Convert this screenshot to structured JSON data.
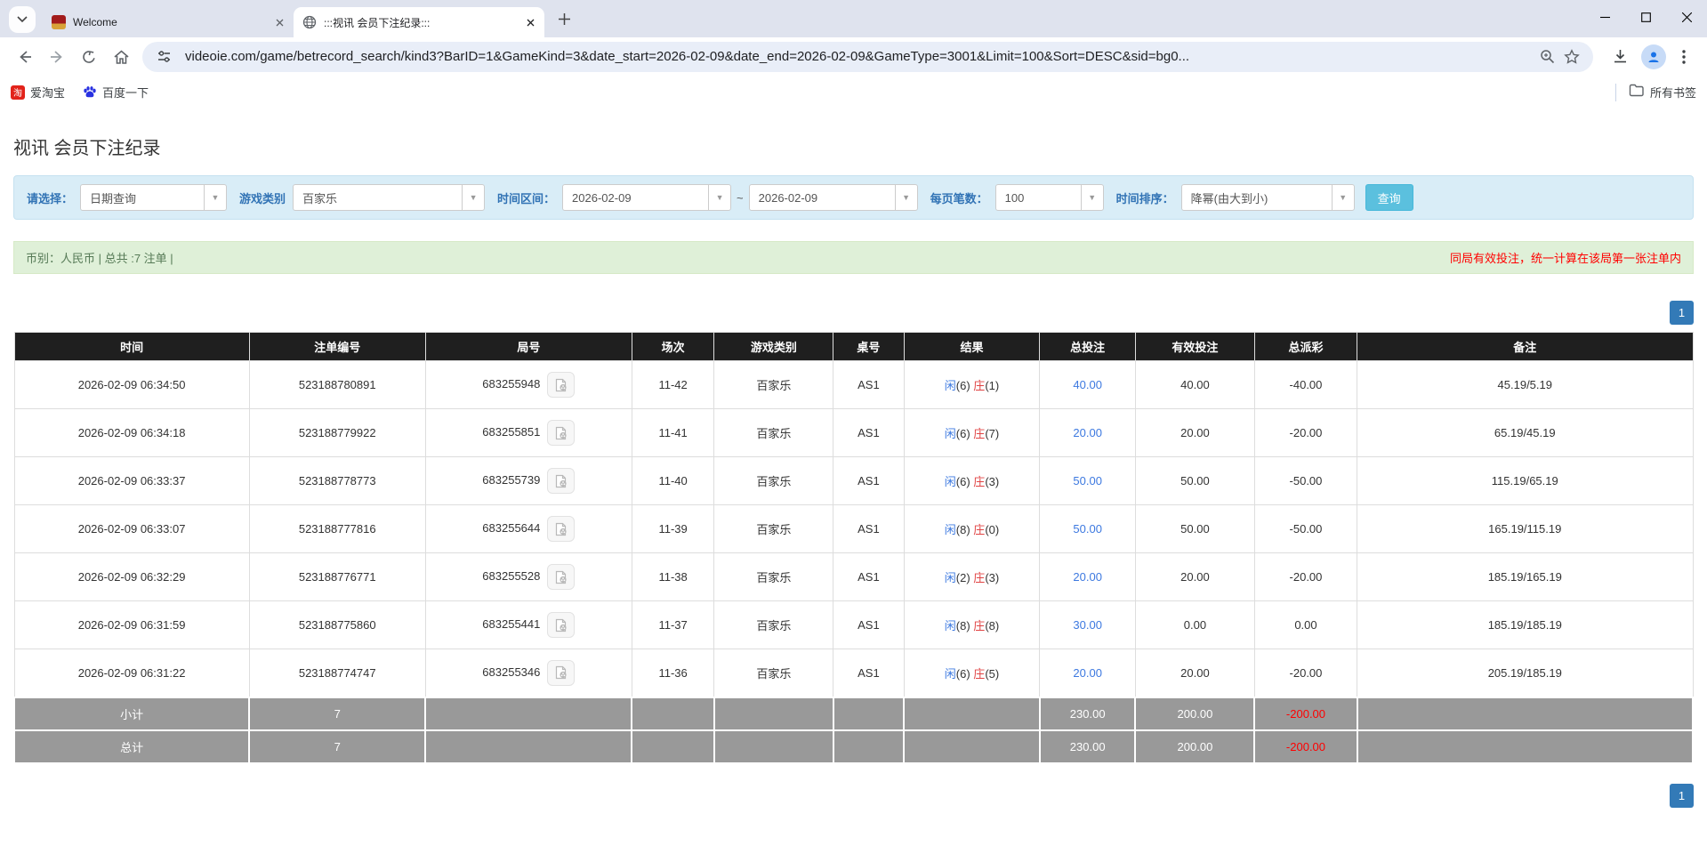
{
  "browser": {
    "tabs": [
      {
        "title": "Welcome"
      },
      {
        "title": ":::视讯 会员下注纪录:::"
      }
    ],
    "url": "videoie.com/game/betrecord_search/kind3?BarID=1&GameKind=3&date_start=2026-02-09&date_end=2026-02-09&GameType=3001&Limit=100&Sort=DESC&sid=bg0...",
    "bookmarks": [
      {
        "label": "爱淘宝",
        "icon": "taobao-icon",
        "icon_char": "淘"
      },
      {
        "label": "百度一下",
        "icon": "baidu-paw-icon"
      }
    ],
    "bookmarks_right": "所有书签"
  },
  "page": {
    "title": "视讯 会员下注纪录",
    "filters": {
      "select_label": "请选择：",
      "select_value": "日期查询",
      "game_label": "游戏类别",
      "game_value": "百家乐",
      "range_label": "时间区间：",
      "date_start": "2026-02-09",
      "tilde": "~",
      "date_end": "2026-02-09",
      "per_page_label": "每页笔数：",
      "per_page_value": "100",
      "sort_label": "时间排序：",
      "sort_value": "降幂(由大到小)",
      "search_button": "查询"
    },
    "info_bar": {
      "left": "币别：人民币 | 总共 :7 注单 |",
      "right": "同局有效投注，统一计算在该局第一张注单内"
    },
    "pagination": "1",
    "colors": {
      "accent_blue": "#3d79e0",
      "banker_red": "#e04343",
      "negative_red": "#ff0000",
      "header_bg": "#1f1f1f",
      "summary_bg": "#999999",
      "filter_bg": "#d9edf7",
      "info_bg": "#dff0d8",
      "search_btn": "#5bc0de",
      "pager_btn": "#337ab7"
    },
    "table": {
      "headers": [
        "时间",
        "注单编号",
        "局号",
        "场次",
        "游戏类别",
        "桌号",
        "结果",
        "总投注",
        "有效投注",
        "总派彩",
        "备注"
      ],
      "col_widths": [
        "14%",
        "10.5%",
        "12.3%",
        "4.9%",
        "7.1%",
        "4.2%",
        "8.1%",
        "5.7%",
        "7.1%",
        "6.1%",
        "20%"
      ],
      "rows": [
        {
          "time": "2026-02-09 06:34:50",
          "bet_id": "523188780891",
          "round": "683255948",
          "session": "11-42",
          "game": "百家乐",
          "table_no": "AS1",
          "result_player": "闲(6)",
          "result_banker": "庄(1)",
          "total_bet": "40.00",
          "valid_bet": "40.00",
          "payout": "-40.00",
          "payout_negative": true,
          "remark": "45.19/5.19"
        },
        {
          "time": "2026-02-09 06:34:18",
          "bet_id": "523188779922",
          "round": "683255851",
          "session": "11-41",
          "game": "百家乐",
          "table_no": "AS1",
          "result_player": "闲(6)",
          "result_banker": "庄(7)",
          "total_bet": "20.00",
          "valid_bet": "20.00",
          "payout": "-20.00",
          "payout_negative": true,
          "remark": "65.19/45.19"
        },
        {
          "time": "2026-02-09 06:33:37",
          "bet_id": "523188778773",
          "round": "683255739",
          "session": "11-40",
          "game": "百家乐",
          "table_no": "AS1",
          "result_player": "闲(6)",
          "result_banker": "庄(3)",
          "total_bet": "50.00",
          "valid_bet": "50.00",
          "payout": "-50.00",
          "payout_negative": true,
          "remark": "115.19/65.19"
        },
        {
          "time": "2026-02-09 06:33:07",
          "bet_id": "523188777816",
          "round": "683255644",
          "session": "11-39",
          "game": "百家乐",
          "table_no": "AS1",
          "result_player": "闲(8)",
          "result_banker": "庄(0)",
          "total_bet": "50.00",
          "valid_bet": "50.00",
          "payout": "-50.00",
          "payout_negative": true,
          "remark": "165.19/115.19"
        },
        {
          "time": "2026-02-09 06:32:29",
          "bet_id": "523188776771",
          "round": "683255528",
          "session": "11-38",
          "game": "百家乐",
          "table_no": "AS1",
          "result_player": "闲(2)",
          "result_banker": "庄(3)",
          "total_bet": "20.00",
          "valid_bet": "20.00",
          "payout": "-20.00",
          "payout_negative": true,
          "remark": "185.19/165.19"
        },
        {
          "time": "2026-02-09 06:31:59",
          "bet_id": "523188775860",
          "round": "683255441",
          "session": "11-37",
          "game": "百家乐",
          "table_no": "AS1",
          "result_player": "闲(8)",
          "result_banker": "庄(8)",
          "total_bet": "30.00",
          "valid_bet": "0.00",
          "payout": "0.00",
          "payout_negative": false,
          "remark": "185.19/185.19"
        },
        {
          "time": "2026-02-09 06:31:22",
          "bet_id": "523188774747",
          "round": "683255346",
          "session": "11-36",
          "game": "百家乐",
          "table_no": "AS1",
          "result_player": "闲(6)",
          "result_banker": "庄(5)",
          "total_bet": "20.00",
          "valid_bet": "20.00",
          "payout": "-20.00",
          "payout_negative": true,
          "remark": "205.19/185.19"
        }
      ],
      "subtotal": {
        "label": "小计",
        "count": "7",
        "total_bet": "230.00",
        "valid_bet": "200.00",
        "payout": "-200.00"
      },
      "total": {
        "label": "总计",
        "count": "7",
        "total_bet": "230.00",
        "valid_bet": "200.00",
        "payout": "-200.00"
      }
    }
  }
}
